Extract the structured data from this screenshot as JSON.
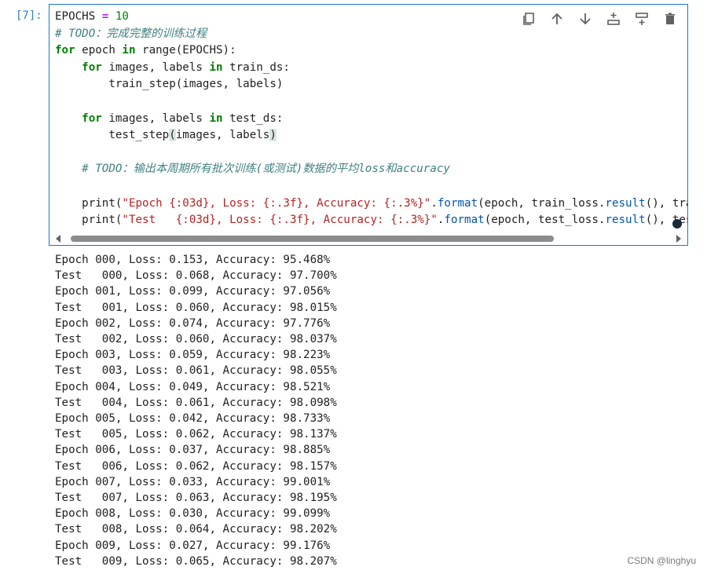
{
  "cell": {
    "prompt": "[7]:",
    "code_lines": [
      [
        {
          "t": "EPOCHS ",
          "c": ""
        },
        {
          "t": "=",
          "c": "op"
        },
        {
          "t": " ",
          "c": ""
        },
        {
          "t": "10",
          "c": "num"
        }
      ],
      [
        {
          "t": "# TODO：完成完整的训练过程",
          "c": "cm"
        }
      ],
      [
        {
          "t": "for",
          "c": "kw"
        },
        {
          "t": " epoch ",
          "c": ""
        },
        {
          "t": "in",
          "c": "kw"
        },
        {
          "t": " range(EPOCHS):",
          "c": ""
        }
      ],
      [
        {
          "t": "    ",
          "c": ""
        },
        {
          "t": "for",
          "c": "kw"
        },
        {
          "t": " images, labels ",
          "c": ""
        },
        {
          "t": "in",
          "c": "kw"
        },
        {
          "t": " train_ds:",
          "c": ""
        }
      ],
      [
        {
          "t": "        train_step(images, labels)",
          "c": ""
        }
      ],
      [
        {
          "t": "",
          "c": ""
        }
      ],
      [
        {
          "t": "    ",
          "c": ""
        },
        {
          "t": "for",
          "c": "kw"
        },
        {
          "t": " images, labels ",
          "c": ""
        },
        {
          "t": "in",
          "c": "kw"
        },
        {
          "t": " test_ds:",
          "c": ""
        }
      ],
      [
        {
          "t": "        test_step",
          "c": ""
        },
        {
          "t": "(",
          "c": "bracket"
        },
        {
          "t": "images, labels",
          "c": ""
        },
        {
          "t": ")",
          "c": "bracket"
        }
      ],
      [
        {
          "t": "",
          "c": ""
        }
      ],
      [
        {
          "t": "    ",
          "c": ""
        },
        {
          "t": "# TODO：输出本周期所有批次训练(或测试)数据的平均loss和accuracy",
          "c": "cm"
        }
      ],
      [
        {
          "t": "",
          "c": ""
        }
      ],
      [
        {
          "t": "    print(",
          "c": ""
        },
        {
          "t": "\"Epoch {:03d}, Loss: {:.3f}, Accuracy: {:.3%}\"",
          "c": "str"
        },
        {
          "t": ".",
          "c": ""
        },
        {
          "t": "format",
          "c": "fn"
        },
        {
          "t": "(epoch, train_loss.",
          "c": ""
        },
        {
          "t": "result",
          "c": "fn"
        },
        {
          "t": "(), tra",
          "c": ""
        }
      ],
      [
        {
          "t": "    print(",
          "c": ""
        },
        {
          "t": "\"Test   {:03d}, Loss: {:.3f}, Accuracy: {:.3%}\"",
          "c": "str"
        },
        {
          "t": ".",
          "c": ""
        },
        {
          "t": "format",
          "c": "fn"
        },
        {
          "t": "(epoch, test_loss.",
          "c": ""
        },
        {
          "t": "result",
          "c": "fn"
        },
        {
          "t": "(), tes",
          "c": ""
        }
      ]
    ],
    "toolbar": [
      {
        "name": "duplicate-cell-icon"
      },
      {
        "name": "move-up-icon"
      },
      {
        "name": "move-down-icon"
      },
      {
        "name": "insert-above-icon"
      },
      {
        "name": "insert-below-icon"
      },
      {
        "name": "delete-cell-icon"
      }
    ]
  },
  "output_lines": [
    "Epoch 000, Loss: 0.153, Accuracy: 95.468%",
    "Test   000, Loss: 0.068, Accuracy: 97.700%",
    "Epoch 001, Loss: 0.099, Accuracy: 97.056%",
    "Test   001, Loss: 0.060, Accuracy: 98.015%",
    "Epoch 002, Loss: 0.074, Accuracy: 97.776%",
    "Test   002, Loss: 0.060, Accuracy: 98.037%",
    "Epoch 003, Loss: 0.059, Accuracy: 98.223%",
    "Test   003, Loss: 0.061, Accuracy: 98.055%",
    "Epoch 004, Loss: 0.049, Accuracy: 98.521%",
    "Test   004, Loss: 0.061, Accuracy: 98.098%",
    "Epoch 005, Loss: 0.042, Accuracy: 98.733%",
    "Test   005, Loss: 0.062, Accuracy: 98.137%",
    "Epoch 006, Loss: 0.037, Accuracy: 98.885%",
    "Test   006, Loss: 0.062, Accuracy: 98.157%",
    "Epoch 007, Loss: 0.033, Accuracy: 99.001%",
    "Test   007, Loss: 0.063, Accuracy: 98.195%",
    "Epoch 008, Loss: 0.030, Accuracy: 99.099%",
    "Test   008, Loss: 0.064, Accuracy: 98.202%",
    "Epoch 009, Loss: 0.027, Accuracy: 99.176%",
    "Test   009, Loss: 0.065, Accuracy: 98.207%"
  ],
  "watermark": "CSDN @linghyu"
}
